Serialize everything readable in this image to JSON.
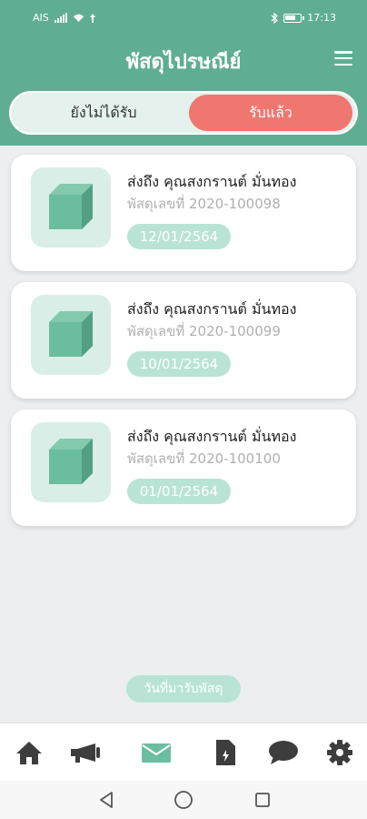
{
  "status_bar": {
    "carrier": "AIS",
    "time": "17:13",
    "icons": [
      "signal-icon",
      "wifi-icon",
      "bluetooth-icon",
      "battery-icon"
    ]
  },
  "header": {
    "title": "พัสดุไปรษณีย์",
    "menu_icon": "hamburger-menu-icon"
  },
  "tabs": [
    {
      "label": "ยังไม่ได้รับ",
      "active": false
    },
    {
      "label": "รับแล้ว",
      "active": true
    }
  ],
  "parcels": [
    {
      "recipient": "ส่งถึง คุณสงกรานต์ มั่นทอง",
      "parcel_no": "พัสดุเลขที่ 2020-100098",
      "date": "12/01/2564"
    },
    {
      "recipient": "ส่งถึง คุณสงกรานต์ มั่นทอง",
      "parcel_no": "พัสดุเลขที่ 2020-100099",
      "date": "10/01/2564"
    },
    {
      "recipient": "ส่งถึง คุณสงกรานต์ มั่นทอง",
      "parcel_no": "พัสดุเลขที่ 2020-100100",
      "date": "01/01/2564"
    }
  ],
  "legend": {
    "date_label": "วันที่มารับพัสดุ"
  },
  "bottom_nav": [
    {
      "name": "home",
      "icon": "home-icon",
      "active": false
    },
    {
      "name": "announcements",
      "icon": "megaphone-icon",
      "active": false
    },
    {
      "name": "mail",
      "icon": "mail-icon",
      "active": true
    },
    {
      "name": "documents",
      "icon": "document-icon",
      "active": false
    },
    {
      "name": "chat",
      "icon": "chat-icon",
      "active": false
    },
    {
      "name": "settings",
      "icon": "gear-icon",
      "active": false
    }
  ],
  "system_nav": [
    "back-icon",
    "home-circle-icon",
    "recents-icon"
  ],
  "colors": {
    "primary": "#5fae94",
    "accent": "#f07670",
    "chip": "#b9e4d5",
    "thumb_bg": "#d9eee6",
    "box": "#6bbd9f",
    "nav_icon": "#3d3d3d"
  }
}
